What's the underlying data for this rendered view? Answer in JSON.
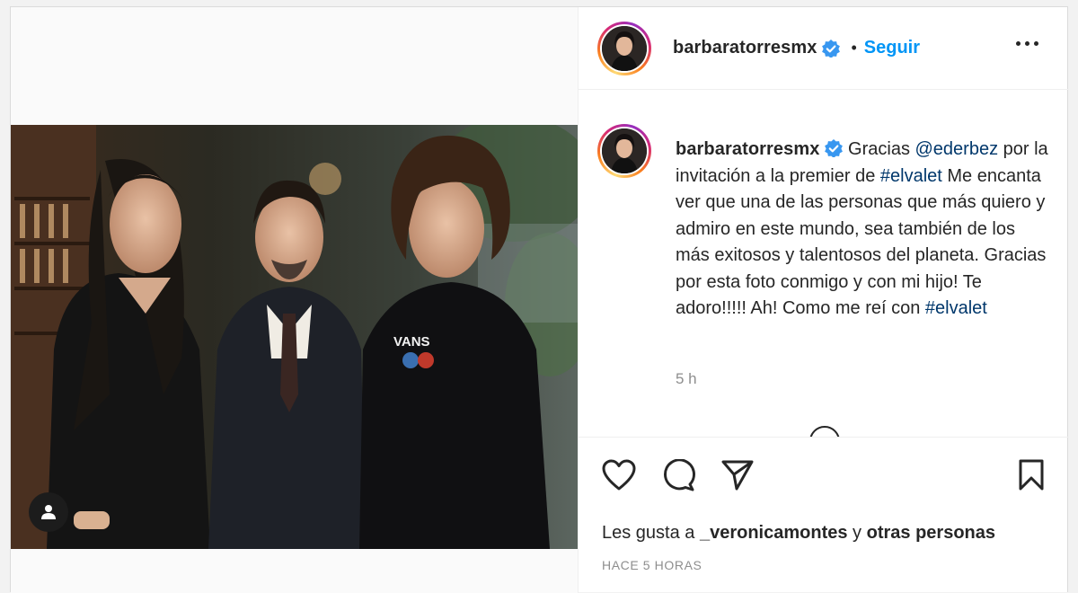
{
  "post": {
    "username": "barbaratorresmx",
    "follow_label": "Seguir",
    "dot": "•"
  },
  "caption": {
    "username": "barbaratorresmx",
    "text_1": "Gracias ",
    "mention": "@ederbez",
    "text_2": " por la invitación a la premier de ",
    "hashtag_1": "#elvalet",
    "text_3": " Me encanta ver que una de las personas que más quiero y admiro en este mundo, sea también de los más exitosos y talentosos del planeta. Gracias por esta foto conmigo y con mi hijo! Te adoro!!!!! Ah! Como me reí con ",
    "hashtag_2": "#elvalet",
    "time": "5 h"
  },
  "likes": {
    "prefix": "Les gusta a ",
    "user": "_veronicamontes",
    "middle": " y ",
    "others": "otras personas"
  },
  "posted_ago": "HACE 5 HORAS",
  "photo": {
    "shirt_text": "VANS"
  },
  "colors": {
    "accent": "#0095f6",
    "link": "#00376b",
    "verified": "#3897f0",
    "secondary_text": "#8e8e8e"
  },
  "icons": [
    "user-tag-icon",
    "verified-badge-icon",
    "more-options-icon",
    "heart-icon",
    "comment-icon",
    "share-icon",
    "bookmark-icon",
    "loading-spinner-icon"
  ]
}
